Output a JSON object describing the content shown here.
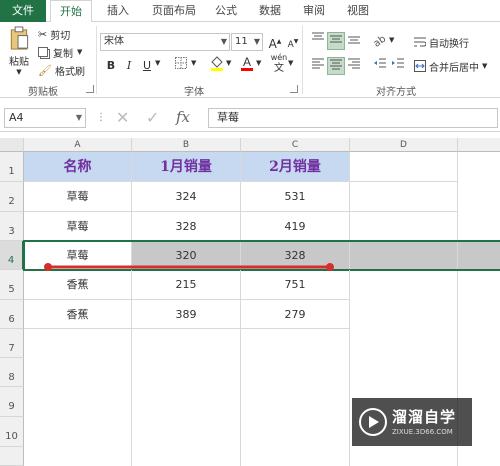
{
  "ribbon_tabs": [
    "文件",
    "开始",
    "插入",
    "页面布局",
    "公式",
    "数据",
    "审阅",
    "视图"
  ],
  "clipboard": {
    "paste": "粘贴",
    "cut": "剪切",
    "copy": "复制",
    "format_painter": "格式刷",
    "group_label": "剪贴板"
  },
  "font": {
    "name": "宋体",
    "size": "11",
    "bold": "B",
    "italic": "I",
    "underline": "U",
    "grow": "A",
    "shrink": "A",
    "phonetic_top": "wén",
    "phonetic_bottom": "文",
    "group_label": "字体"
  },
  "alignment": {
    "wrap_text": "自动换行",
    "merge_center": "合并后居中",
    "group_label": "对齐方式"
  },
  "formula_bar": {
    "name_box": "A4",
    "fx": "fx",
    "content": "草莓"
  },
  "columns": [
    "A",
    "B",
    "C",
    "D"
  ],
  "rows": [
    "1",
    "2",
    "3",
    "4",
    "5",
    "6",
    "7",
    "8",
    "9",
    "10"
  ],
  "table": {
    "headers": [
      "名称",
      "1月销量",
      "2月销量"
    ],
    "rows": [
      [
        "草莓",
        "324",
        "531"
      ],
      [
        "草莓",
        "328",
        "419"
      ],
      [
        "草莓",
        "320",
        "328"
      ],
      [
        "香蕉",
        "215",
        "751"
      ],
      [
        "香蕉",
        "389",
        "279"
      ]
    ]
  },
  "watermark": {
    "brand": "溜溜自学",
    "url": "ZIXUE.3D66.COM"
  },
  "colors": {
    "accent": "#217346",
    "header_fill": "#c6d9f0",
    "header_text": "#7030a0",
    "annotation": "#d32f2f",
    "selection": "#c8c8c8"
  }
}
